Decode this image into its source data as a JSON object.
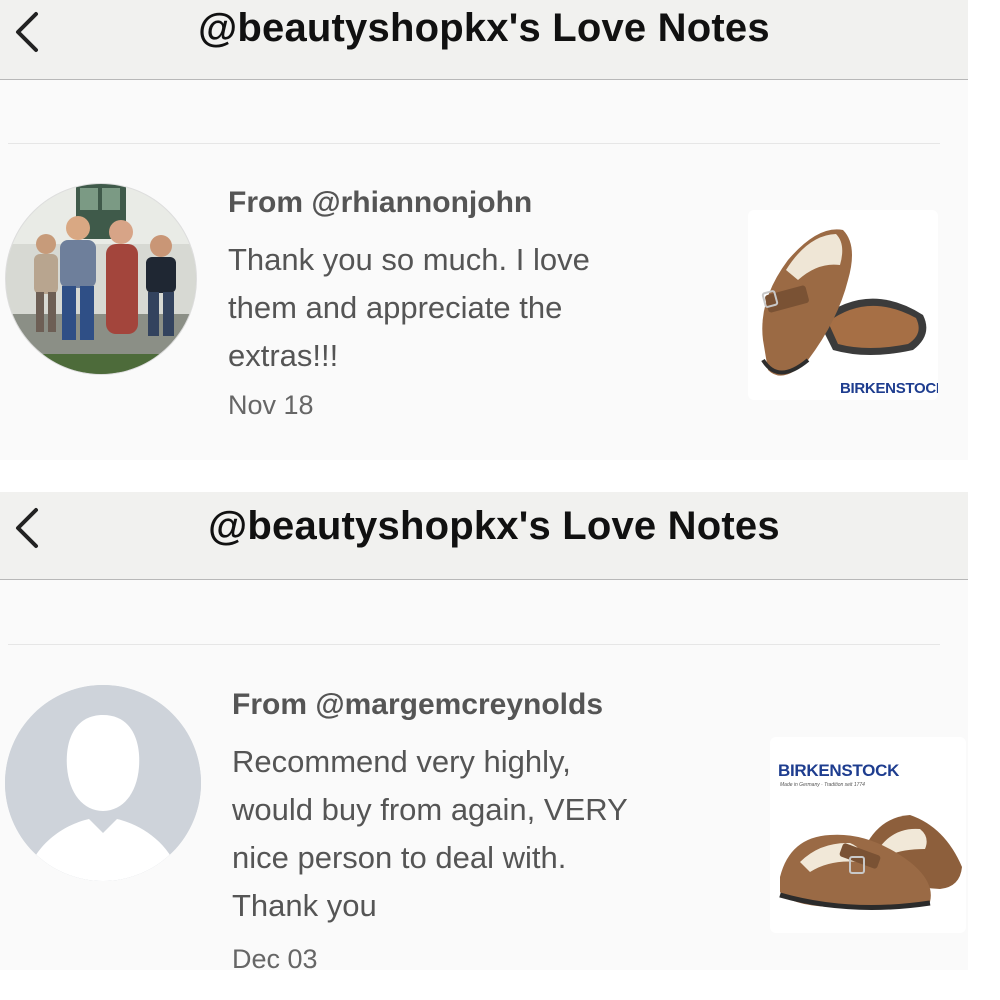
{
  "screens": [
    {
      "header": {
        "back_icon": "chevron-left-icon",
        "title": "@beautyshopkx's Love Notes"
      },
      "note": {
        "from": "From @rhiannonjohn",
        "message_lines": [
          "Thank you so much. I love",
          "them and appreciate the",
          "extras!!!"
        ],
        "date": "Nov 18",
        "avatar": "family-photo-avatar",
        "product": {
          "image": "birkenstock-clog",
          "brand": "BIRKENSTOCK"
        }
      }
    },
    {
      "header": {
        "back_icon": "chevron-left-icon",
        "title": "@beautyshopkx's Love Notes"
      },
      "note": {
        "from": "From @margemcreynolds",
        "message_lines": [
          "Recommend very highly,",
          "would buy from again, VERY",
          "nice person to deal with.",
          "Thank you"
        ],
        "date": "Dec 03",
        "avatar": "default-user-avatar",
        "product": {
          "image": "birkenstock-clog",
          "brand": "BIRKENSTOCK",
          "tagline": "Made in Germany · Tradition seit 1774"
        }
      }
    }
  ],
  "colors": {
    "header_bg": "#f1f1ef",
    "text": "#555555",
    "title": "#111111",
    "brand": "#1e3d8f"
  }
}
